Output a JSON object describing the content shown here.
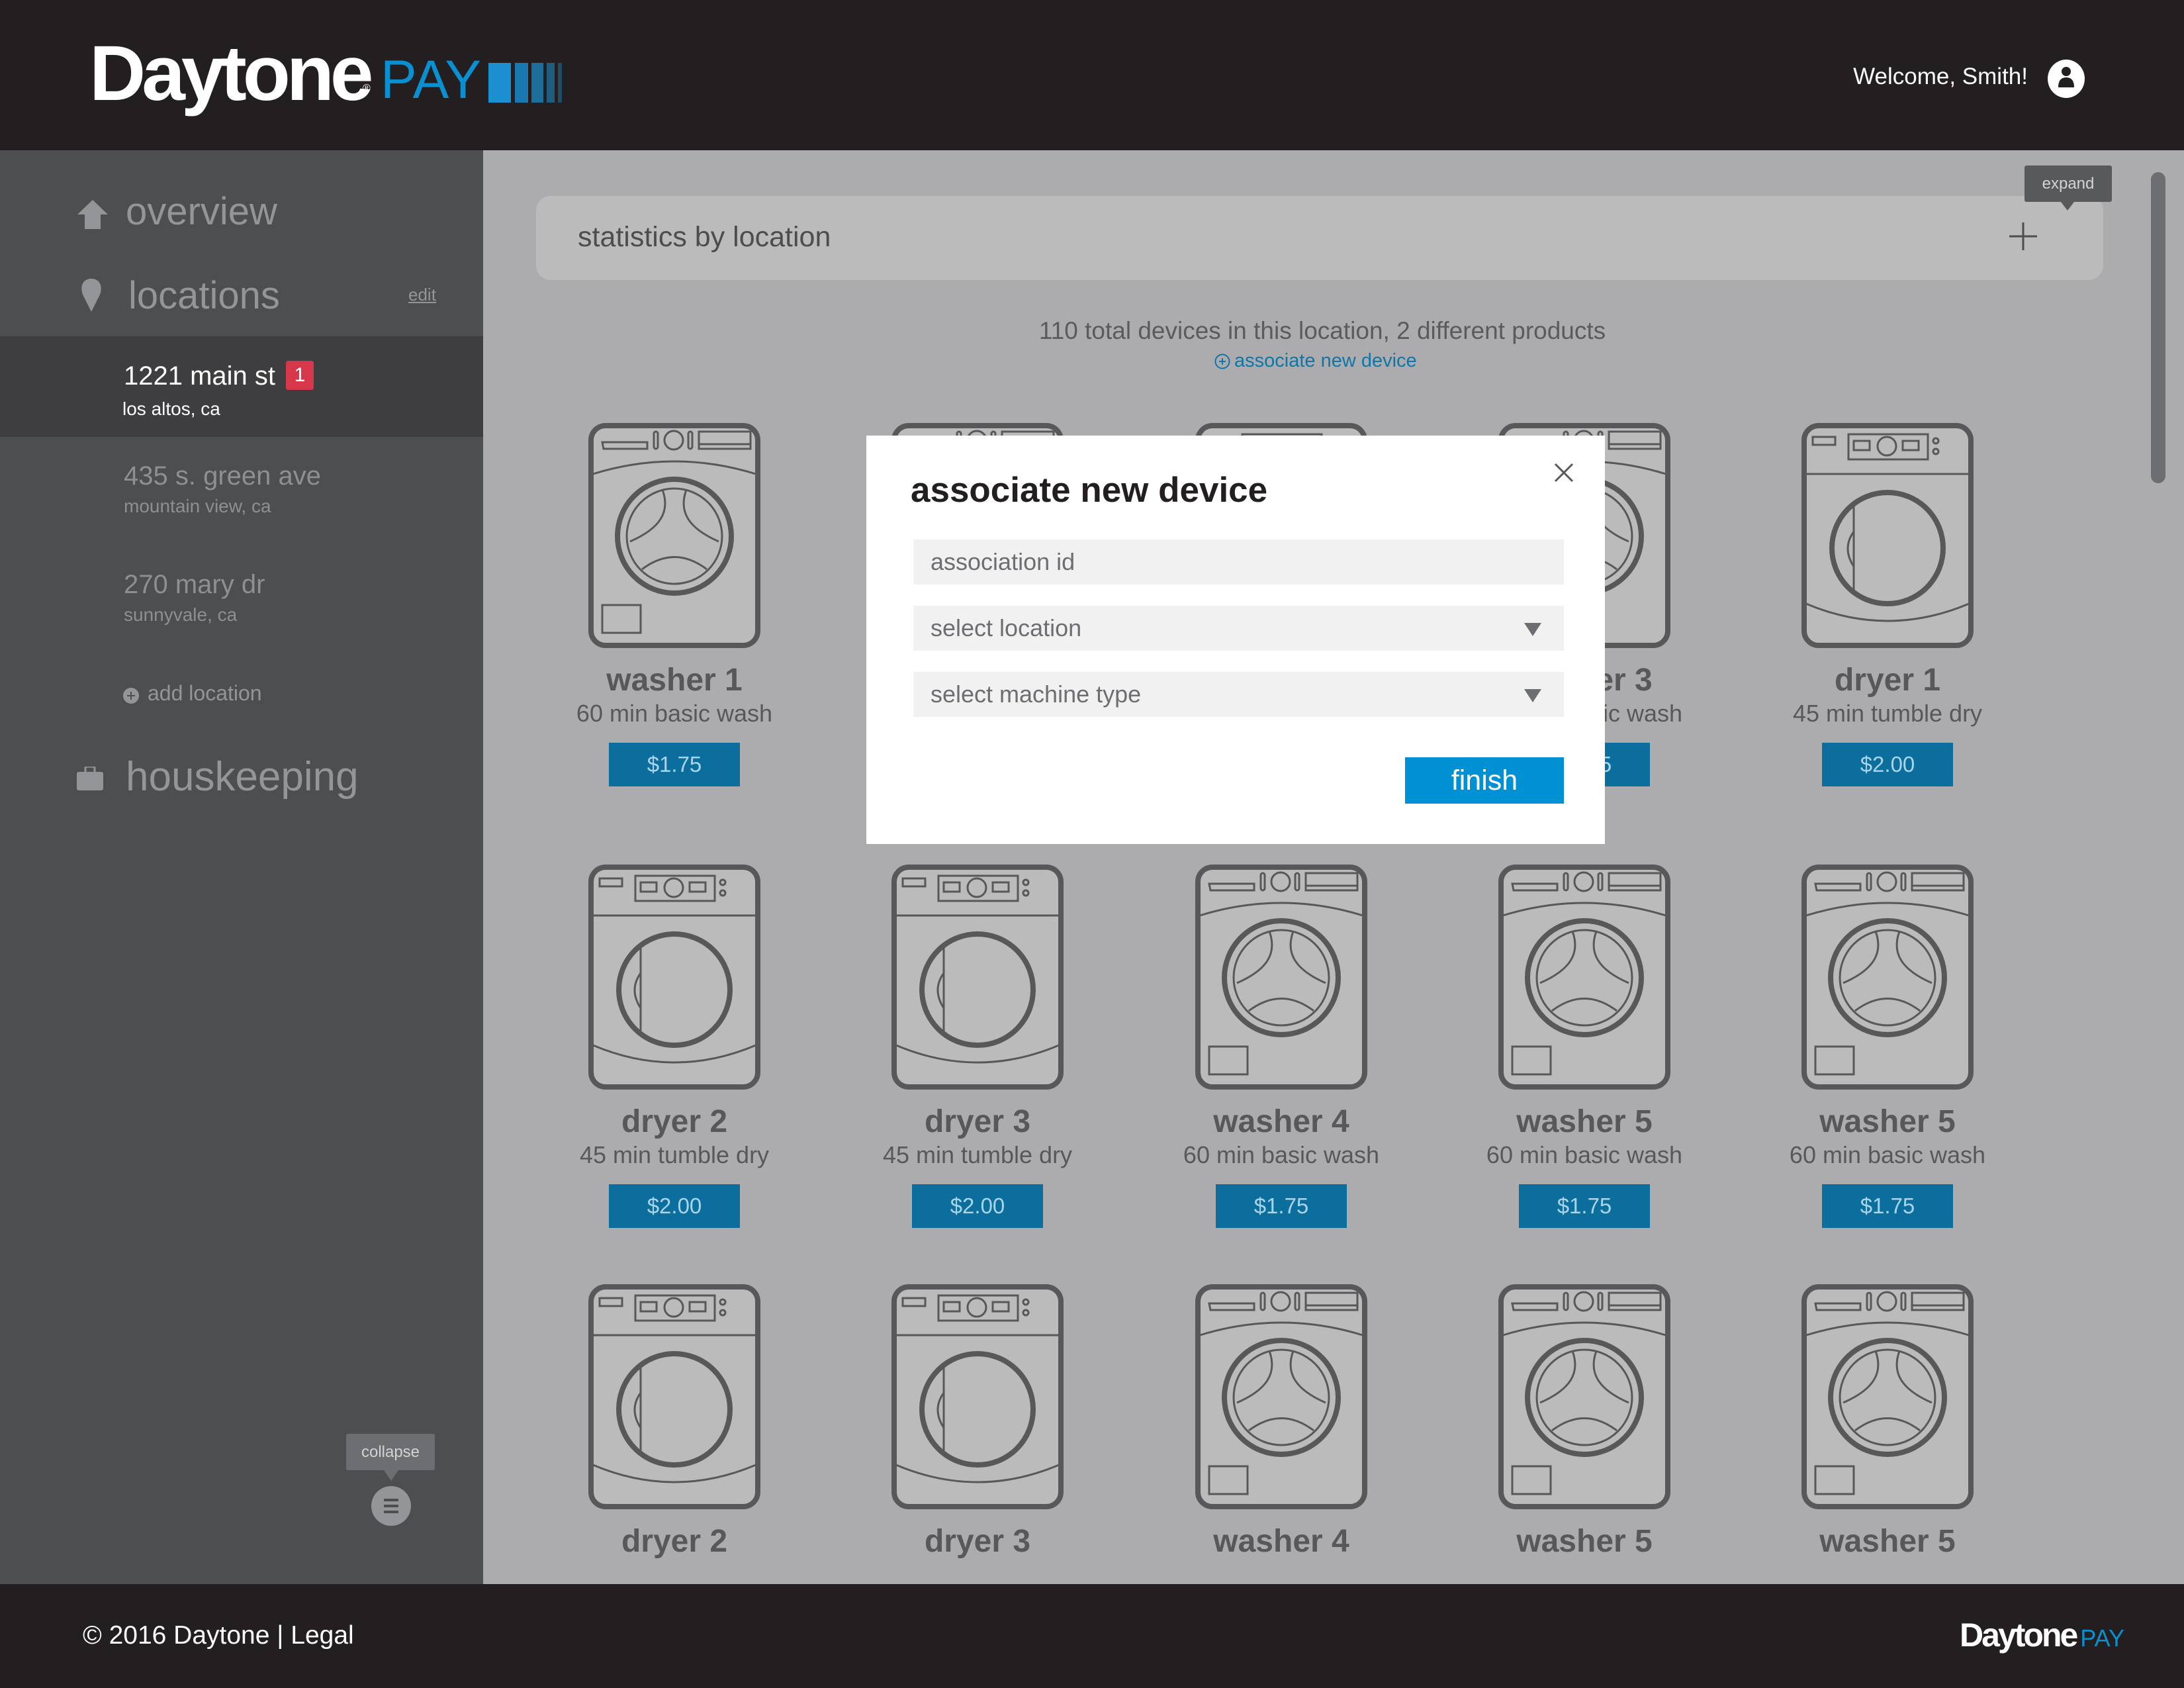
{
  "header": {
    "logo_brand": "Daytone",
    "logo_product": "PAY",
    "welcome": "Welcome, Smith!",
    "avatar_icon": "user-icon"
  },
  "sidebar": {
    "overview": {
      "label": "overview",
      "icon": "home-icon"
    },
    "locations": {
      "label": "locations",
      "icon": "map-pin-icon",
      "edit": "edit"
    },
    "location_items": [
      {
        "name": "1221 main st",
        "city": "los altos, ca",
        "badge": "1",
        "active": true
      },
      {
        "name": "435 s. green ave",
        "city": "mountain view, ca",
        "active": false
      },
      {
        "name": "270 mary dr",
        "city": "sunnyvale, ca",
        "active": false
      }
    ],
    "add_location": "add location",
    "housekeeping": {
      "label": "houskeeping",
      "icon": "briefcase-icon"
    },
    "collapse_tooltip": "collapse"
  },
  "main": {
    "stats_title": "statistics by location",
    "expand_tooltip": "expand",
    "summary": "110 total devices in this location, 2 different products",
    "associate_link": "associate new device",
    "devices": [
      {
        "type": "washer",
        "name": "washer 1",
        "desc": "60 min basic wash",
        "price": "$1.75"
      },
      {
        "type": "washer"
      },
      {
        "type": "dryer"
      },
      {
        "type": "washer",
        "name": "washer 3",
        "desc": "60 min basic wash",
        "price": "$1.75"
      },
      {
        "type": "dryer",
        "name": "dryer 1",
        "desc": "45 min tumble dry",
        "price": "$2.00"
      },
      {
        "type": "dryer",
        "name": "dryer 2",
        "desc": "45 min tumble dry",
        "price": "$2.00"
      },
      {
        "type": "dryer",
        "name": "dryer 3",
        "desc": "45 min tumble dry",
        "price": "$2.00"
      },
      {
        "type": "washer",
        "name": "washer 4",
        "desc": "60 min basic wash",
        "price": "$1.75"
      },
      {
        "type": "washer",
        "name": "washer 5",
        "desc": "60 min basic wash",
        "price": "$1.75"
      },
      {
        "type": "washer",
        "name": "washer 5",
        "desc": "60 min basic wash",
        "price": "$1.75"
      },
      {
        "type": "dryer",
        "name": "dryer 2"
      },
      {
        "type": "dryer",
        "name": "dryer 3"
      },
      {
        "type": "washer",
        "name": "washer 4"
      },
      {
        "type": "washer",
        "name": "washer 5"
      },
      {
        "type": "washer",
        "name": "washer 5"
      }
    ]
  },
  "modal": {
    "title": "associate new device",
    "association_placeholder": "association id",
    "location_select": "select location",
    "machine_select": "select machine type",
    "finish": "finish"
  },
  "footer": {
    "copyright": "© 2016 Daytone",
    "separator": "|",
    "legal": "Legal",
    "logo_brand": "Daytone",
    "logo_product": "PAY"
  },
  "colors": {
    "accent": "#0090d4",
    "price_button": "#0b6e9d",
    "badge": "#d7374a",
    "header_bg": "#231f20"
  }
}
